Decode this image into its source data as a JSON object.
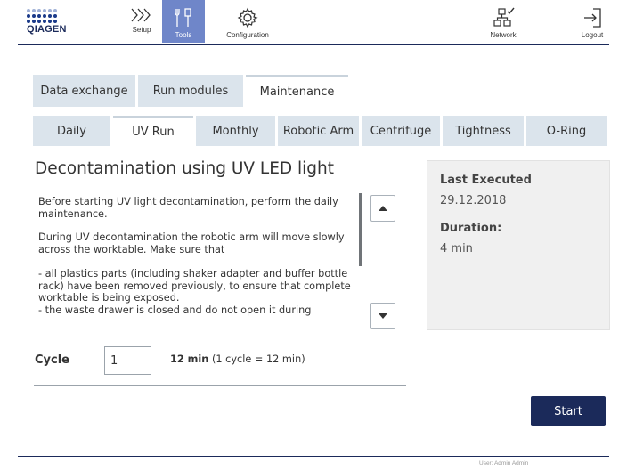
{
  "brand": {
    "logo_text": "QIAGEN"
  },
  "nav": {
    "setup": {
      "label": "Setup",
      "icon": "chevrons-right-icon"
    },
    "tools": {
      "label": "Tools",
      "icon": "tools-icon",
      "active": true
    },
    "configuration": {
      "label": "Configuration",
      "icon": "gear-icon"
    },
    "network": {
      "label": "Network",
      "icon": "network-icon"
    },
    "logout": {
      "label": "Logout",
      "icon": "logout-icon"
    }
  },
  "main_tabs": [
    {
      "label": "Data exchange"
    },
    {
      "label": "Run modules"
    },
    {
      "label": "Maintenance",
      "active": true
    }
  ],
  "sub_tabs": [
    {
      "label": "Daily"
    },
    {
      "label": "UV Run",
      "active": true
    },
    {
      "label": "Monthly"
    },
    {
      "label": "Robotic Arm"
    },
    {
      "label": "Centrifuge"
    },
    {
      "label": "Tightness"
    },
    {
      "label": "O-Ring"
    }
  ],
  "content": {
    "heading": "Decontamination using UV LED light",
    "paragraphs": [
      "Before starting UV light decontamination, perform the daily maintenance.",
      "During UV decontamination the robotic arm will move slowly across the worktable. Make sure that",
      "- all plastics parts (including shaker adapter and buffer bottle rack) have been removed previously, to ensure that complete worktable is being exposed.",
      "- the waste drawer is closed and do not open it during"
    ]
  },
  "info": {
    "last_executed_label": "Last Executed",
    "last_executed_value": "29.12.2018",
    "duration_label": "Duration:",
    "duration_value": "4 min"
  },
  "cycle": {
    "label": "Cycle",
    "value": "1",
    "time_bold": "12 min",
    "time_detail": "(1 cycle = 12 min)"
  },
  "actions": {
    "start_label": "Start"
  },
  "footer": {
    "user_text": "User: Admin Admin"
  },
  "colors": {
    "brand_navy": "#1b2a5a",
    "tab_inactive": "#dbe4ec",
    "nav_active": "#6f86c9"
  }
}
